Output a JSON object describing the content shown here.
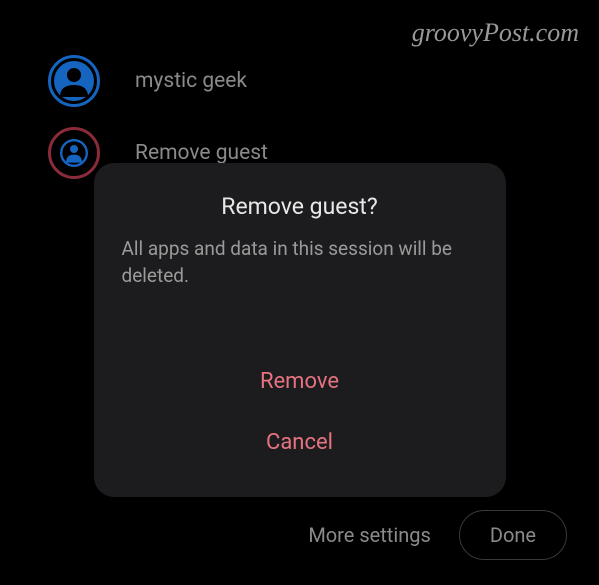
{
  "watermark": "groovyPost.com",
  "users": [
    {
      "name": "mystic geek"
    },
    {
      "name": "Remove guest"
    }
  ],
  "dialog": {
    "title": "Remove guest?",
    "message": "All apps and data in this session will be deleted.",
    "remove_label": "Remove",
    "cancel_label": "Cancel"
  },
  "bottom": {
    "more_settings_label": "More settings",
    "done_label": "Done"
  }
}
